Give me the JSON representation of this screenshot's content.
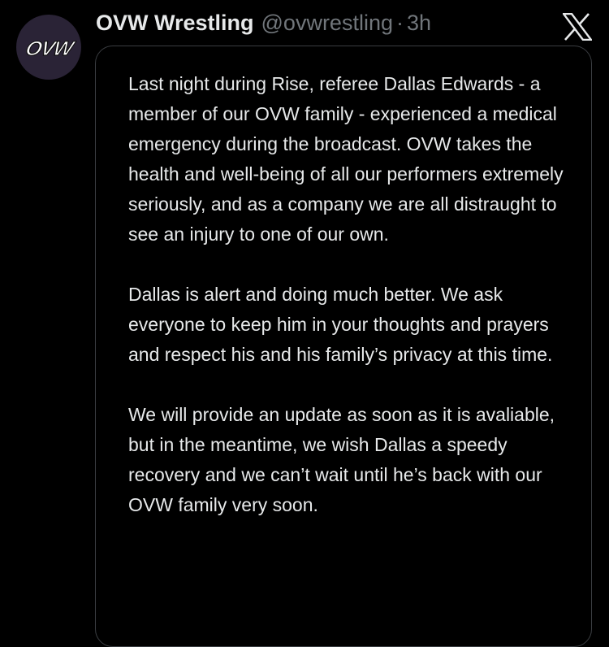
{
  "tweet": {
    "display_name": "OVW Wrestling",
    "handle": "@ovwrestling",
    "separator": "·",
    "time": "3h",
    "avatar_text": "OVW",
    "platform_icon": "x-logo-icon"
  },
  "note": {
    "paragraphs": [
      "Last night during Rise, referee Dallas Edwards - a member of our OVW family - experienced a medical emergency during the broadcast. OVW takes the health and well-being of all our performers extremely seriously, and as a company we are all distraught to see an injury to one of our own.",
      "Dallas is alert and doing much better. We ask everyone to keep him in your thoughts and prayers and respect his and his family’s privacy at this time.",
      "We will provide an update as soon as it is avaliable, but in the meantime, we wish Dallas a speedy recovery and we can’t wait until he’s back with our OVW family very soon."
    ]
  },
  "colors": {
    "background": "#000000",
    "text_primary": "#e7e9ea",
    "text_secondary": "#71767b",
    "card_border": "#3a3d41",
    "avatar_bg": "#2a2336"
  }
}
